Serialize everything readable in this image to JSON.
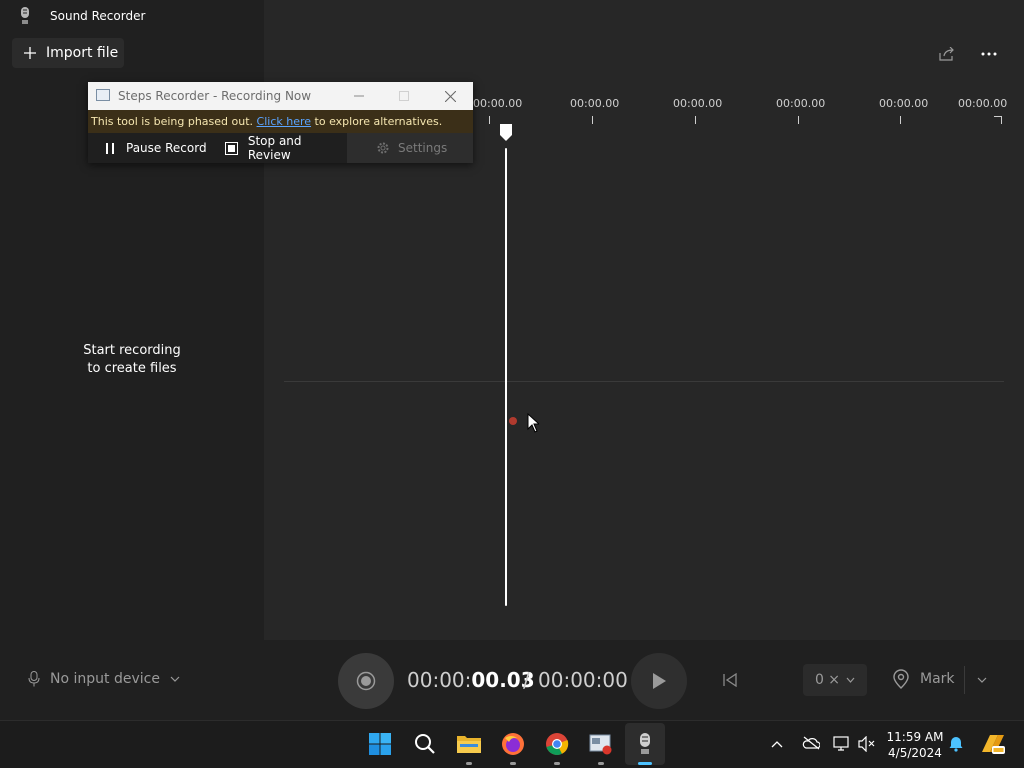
{
  "app": {
    "title": "Sound Recorder"
  },
  "left": {
    "import_label": "Import file",
    "empty_line1": "Start recording",
    "empty_line2": "to create files"
  },
  "timeline": {
    "ticks": [
      "00:00.00",
      "00:00.00",
      "00:00.00",
      "00:00.00",
      "00:00.00",
      "00:00.00"
    ]
  },
  "steps_recorder": {
    "title": "Steps Recorder - Recording Now",
    "banner_prefix": "This tool is being phased out.",
    "banner_link": "Click here",
    "banner_suffix": "to explore alternatives.",
    "pause_label": "Pause Record",
    "stop_label": "Stop and Review",
    "settings_label": "Settings"
  },
  "controls": {
    "input_device": "No input device",
    "time_current_prefix": "00:00:",
    "time_current_main": "00.03",
    "time_separator": "/",
    "time_total": "00:00:00",
    "speed": "0 ×",
    "mark_label": "Mark"
  },
  "taskbar": {
    "time": "11:59 AM",
    "date": "4/5/2024",
    "apps": [
      "start-icon",
      "search-icon",
      "file-explorer-icon",
      "firefox-icon",
      "chrome-icon",
      "steps-recorder-icon",
      "sound-recorder-icon"
    ]
  },
  "colors": {
    "accent": "#4cc2ff",
    "banner_bg": "#3b2f18",
    "link": "#5aa4ff"
  }
}
